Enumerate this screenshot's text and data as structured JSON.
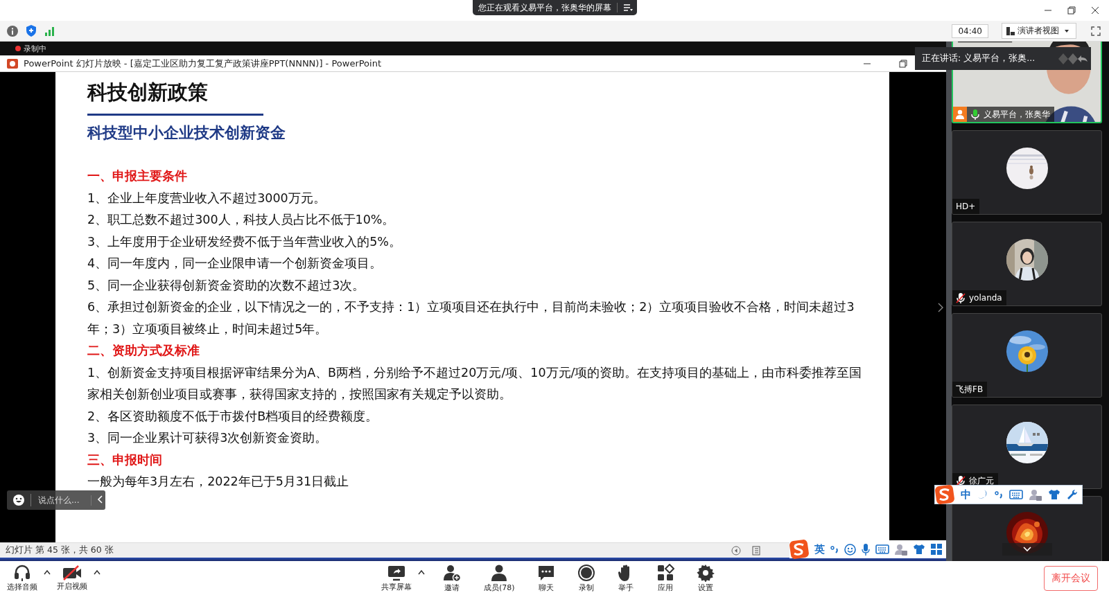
{
  "top_bar": {
    "banner": "您正在观看义易平台，张奥华的屏幕"
  },
  "meeting_bar": {
    "timer": "04:40",
    "view_button": "演讲者视图"
  },
  "recording_label": "录制中",
  "ppt_window": {
    "title": "PowerPoint 幻灯片放映 - [嘉定工业区助力复工复产政策讲座PPT(NNNN)] - PowerPoint"
  },
  "slide": {
    "title": "科技创新政策",
    "subtitle": "科技型中小企业技术创新资金",
    "lines": [
      {
        "kind": "heading",
        "text": "一、申报主要条件"
      },
      {
        "kind": "item",
        "text": "1、企业上年度营业收入不超过3000万元。"
      },
      {
        "kind": "item",
        "text": "2、职工总数不超过300人，科技人员占比不低于10%。"
      },
      {
        "kind": "item",
        "text": "3、上年度用于企业研发经费不低于当年营业收入的5%。"
      },
      {
        "kind": "item",
        "text": "4、同一年度内，同一企业限申请一个创新资金项目。"
      },
      {
        "kind": "item",
        "text": "5、同一企业获得创新资金资助的次数不超过3次。"
      },
      {
        "kind": "item",
        "text": "6、承担过创新资金的企业，以下情况之一的，不予支持：1）立项项目还在执行中，目前尚未验收；2）立项项目验收不合格，时间未超过3年；3）立项项目被终止，时间未超过5年。"
      },
      {
        "kind": "heading",
        "text": "二、资助方式及标准"
      },
      {
        "kind": "item",
        "text": "1、创新资金支持项目根据评审结果分为A、B两档，分别给予不超过20万元/项、10万元/项的资助。在支持项目的基础上，由市科委推荐至国家相关创新创业项目或赛事，获得国家支持的，按照国家有关规定予以资助。"
      },
      {
        "kind": "item",
        "text": "2、各区资助额度不低于市拨付B档项目的经费额度。"
      },
      {
        "kind": "item",
        "text": "3、同一企业累计可获得3次创新资金资助。"
      },
      {
        "kind": "heading",
        "text": "三、申报时间"
      },
      {
        "kind": "item",
        "text": "一般为每年3月左右，2022年已于5月31日截止"
      }
    ]
  },
  "status_bar": {
    "text": "幻灯片 第 45 张，共 60 张",
    "ime_mode": "英"
  },
  "chat_box": {
    "placeholder": "说点什么..."
  },
  "speaking_banner": "正在讲话: 义易平台，张奥...",
  "participants": [
    {
      "kind": "video",
      "name": "义易平台，张奥华",
      "muted": false,
      "speaking": true
    },
    {
      "kind": "snow",
      "name": "HD+",
      "speaking": false
    },
    {
      "kind": "person",
      "name": "yolanda",
      "muted": true,
      "speaking": false
    },
    {
      "kind": "flower",
      "name": "飞搏FB",
      "speaking": false
    },
    {
      "kind": "boat",
      "name": "徐广元",
      "muted": true,
      "speaking": false
    },
    {
      "kind": "fire",
      "speaking": false
    }
  ],
  "ime_toolbar": {
    "mode": "中"
  },
  "toolbar": [
    {
      "kind": "audio",
      "label": "选择音频",
      "has_menu": true
    },
    {
      "kind": "video",
      "label": "开启视频",
      "has_menu": true
    },
    {
      "kind": "share",
      "label": "共享屏幕",
      "has_menu": true
    },
    {
      "kind": "invite",
      "label": "邀请",
      "has_menu": false
    },
    {
      "kind": "members",
      "label": "成员(78)",
      "has_menu": false
    },
    {
      "kind": "chat",
      "label": "聊天",
      "has_menu": false
    },
    {
      "kind": "record",
      "label": "录制",
      "has_menu": false
    },
    {
      "kind": "hand",
      "label": "举手",
      "has_menu": false
    },
    {
      "kind": "apps",
      "label": "应用",
      "has_menu": false
    },
    {
      "kind": "settings",
      "label": "设置",
      "has_menu": false
    }
  ],
  "leave_button": "离开会议"
}
